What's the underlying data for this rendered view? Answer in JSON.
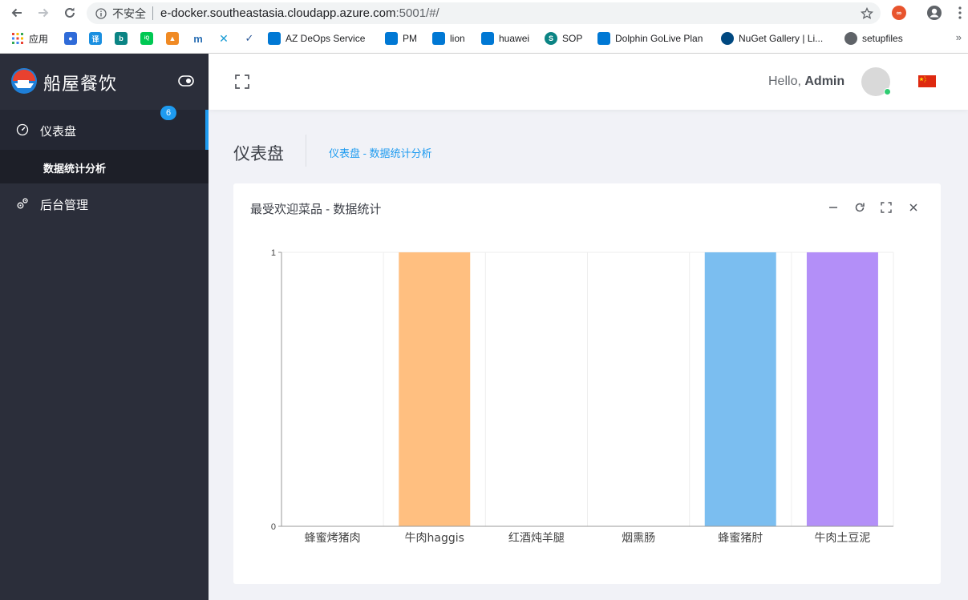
{
  "browser": {
    "insecure_label": "不安全",
    "url_host": "e-docker.southeastasia.cloudapp.azure.com",
    "url_path": ":5001/#/",
    "bookmarks": [
      {
        "label": "应用",
        "icon": "apps-grid-icon",
        "color": "#4285f4"
      },
      {
        "label": "",
        "icon": "baidu-paw-icon",
        "color": "#2f6bd8"
      },
      {
        "label": "",
        "icon": "translate-icon",
        "color": "#1a8fe0"
      },
      {
        "label": "",
        "icon": "bing-icon",
        "color": "#0b8484"
      },
      {
        "label": "",
        "icon": "iqiyi-icon",
        "color": "#00c853"
      },
      {
        "label": "",
        "icon": "grid-app-icon",
        "color": "#f08a24"
      },
      {
        "label": "",
        "icon": "maven-icon",
        "color": "#2a6fb4"
      },
      {
        "label": "",
        "icon": "x-app-icon",
        "color": "#1a9cd4"
      },
      {
        "label": "",
        "icon": "check-app-icon",
        "color": "#2b5797"
      },
      {
        "label": "AZ DeOps Service",
        "icon": "azure-devops-icon",
        "color": "#0078d4"
      },
      {
        "label": "PM",
        "icon": "azure-devops-icon",
        "color": "#0078d4"
      },
      {
        "label": "lion",
        "icon": "azure-devops-icon",
        "color": "#0078d4"
      },
      {
        "label": "huawei",
        "icon": "azure-devops-icon",
        "color": "#0078d4"
      },
      {
        "label": "SOP",
        "icon": "sharepoint-icon",
        "color": "#0b8484"
      },
      {
        "label": "Dolphin GoLive Plan",
        "icon": "azure-devops-icon",
        "color": "#0078d4"
      },
      {
        "label": "NuGet Gallery | Li...",
        "icon": "nuget-icon",
        "color": "#004880"
      },
      {
        "label": "setupfiles",
        "icon": "globe-icon",
        "color": "#5f6368"
      }
    ],
    "more_label": "»"
  },
  "sidebar": {
    "brand": "船屋餐饮",
    "menu": [
      {
        "label": "仪表盘",
        "icon": "dashboard-gauge-icon"
      },
      {
        "label": "数据统计分析",
        "badge": "6"
      },
      {
        "label": "后台管理",
        "icon": "settings-gears-icon"
      }
    ]
  },
  "header": {
    "greeting": "Hello,",
    "username": "Admin"
  },
  "page": {
    "title": "仪表盘",
    "breadcrumb": "仪表盘 - 数据统计分析"
  },
  "card": {
    "title": "最受欢迎菜品 - 数据统计"
  },
  "colors": {
    "accent": "#1e9bf0",
    "sidebar_bg": "#2b2e3a"
  },
  "chart_data": {
    "type": "bar",
    "categories": [
      "蜂蜜烤猪肉",
      "牛肉haggis",
      "红酒炖羊腿",
      "烟熏肠",
      "蜂蜜猪肘",
      "牛肉土豆泥"
    ],
    "values": [
      0,
      1,
      0,
      0,
      1,
      1
    ],
    "colors": [
      "#e46a6b",
      "#ffbf80",
      "#7fd3c9",
      "#9fd27d",
      "#7bbef0",
      "#b38ff8"
    ],
    "yticks": [
      "0",
      "1"
    ],
    "ylim": [
      0,
      1
    ],
    "grid": true
  }
}
